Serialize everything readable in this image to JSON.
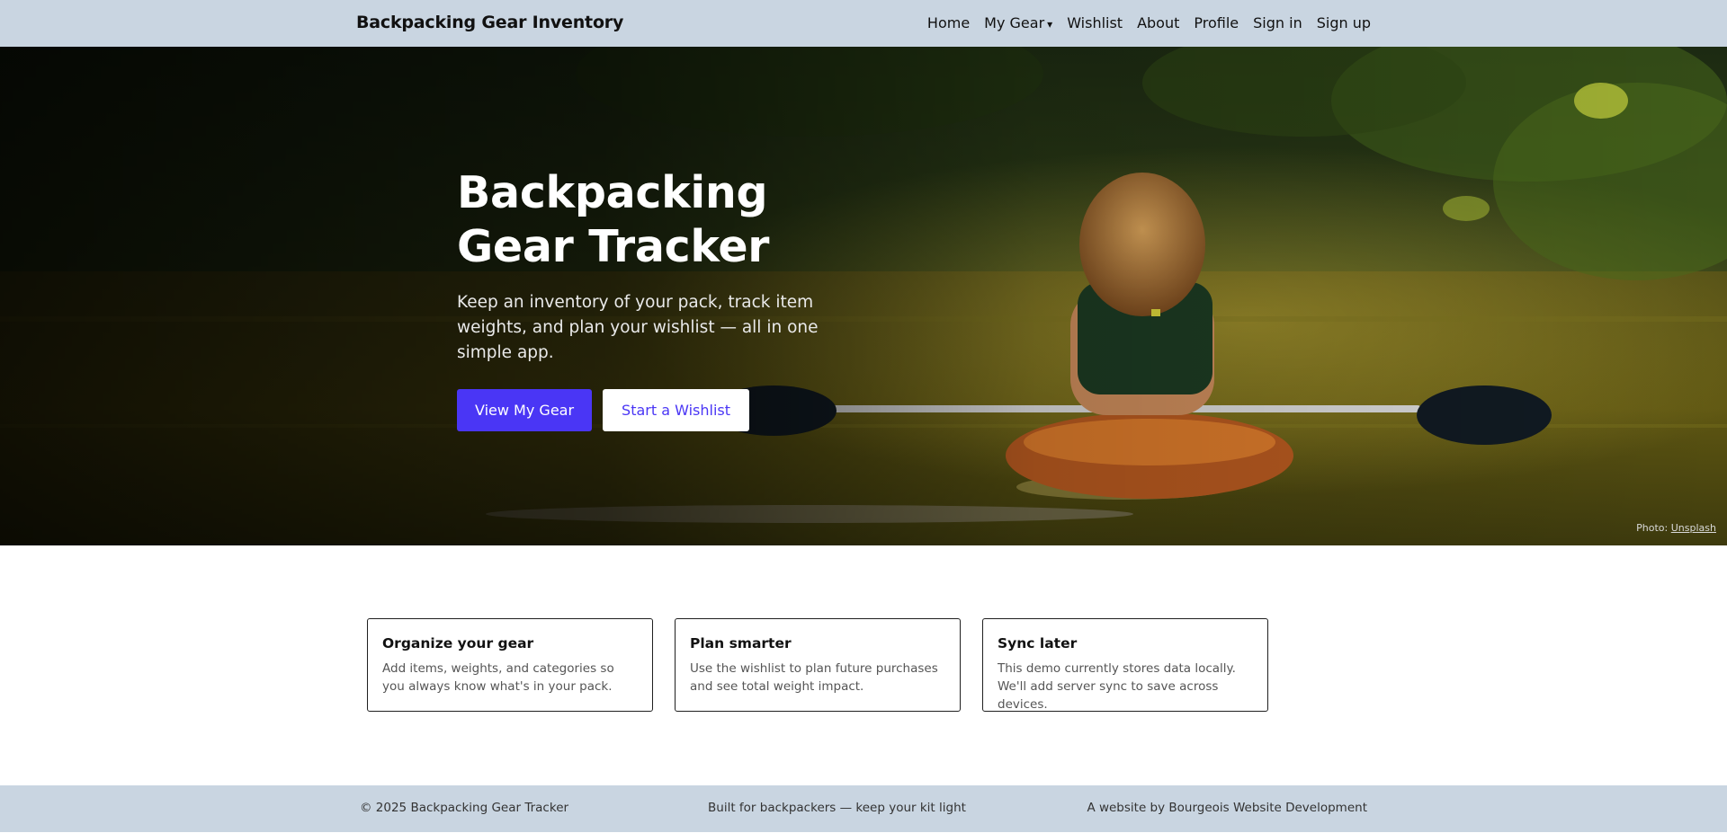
{
  "navbar": {
    "brand": "Backpacking Gear Inventory",
    "links": {
      "home": "Home",
      "my_gear": "My Gear",
      "wishlist": "Wishlist",
      "about": "About",
      "profile": "Profile",
      "sign_in": "Sign in",
      "sign_up": "Sign up"
    },
    "dropdown_caret": "▾"
  },
  "hero": {
    "title": "Backpacking Gear Tracker",
    "subtitle": "Keep an inventory of your pack, track item weights, and plan your wishlist — all in one simple app.",
    "primary_button": "View My Gear",
    "secondary_button": "Start a Wishlist",
    "photo_credit_prefix": "Photo:",
    "photo_credit_link": "Unsplash",
    "image_subject": "person-kayaking-on-forest-river"
  },
  "features": [
    {
      "title": "Organize your gear",
      "text": "Add items, weights, and categories so you always know what's in your pack."
    },
    {
      "title": "Plan smarter",
      "text": "Use the wishlist to plan future purchases and see total weight impact."
    },
    {
      "title": "Sync later",
      "text": "This demo currently stores data locally. We'll add server sync to save across devices."
    }
  ],
  "footer": {
    "copyright": "© 2025 Backpacking Gear Tracker",
    "tagline": "Built for backpackers — keep your kit light",
    "credit": "A website by Bourgeois Website Development"
  },
  "colors": {
    "navbar_bg": "#c9d5e1",
    "accent": "#4a36f5",
    "footer_bg": "#c9d5e1"
  }
}
